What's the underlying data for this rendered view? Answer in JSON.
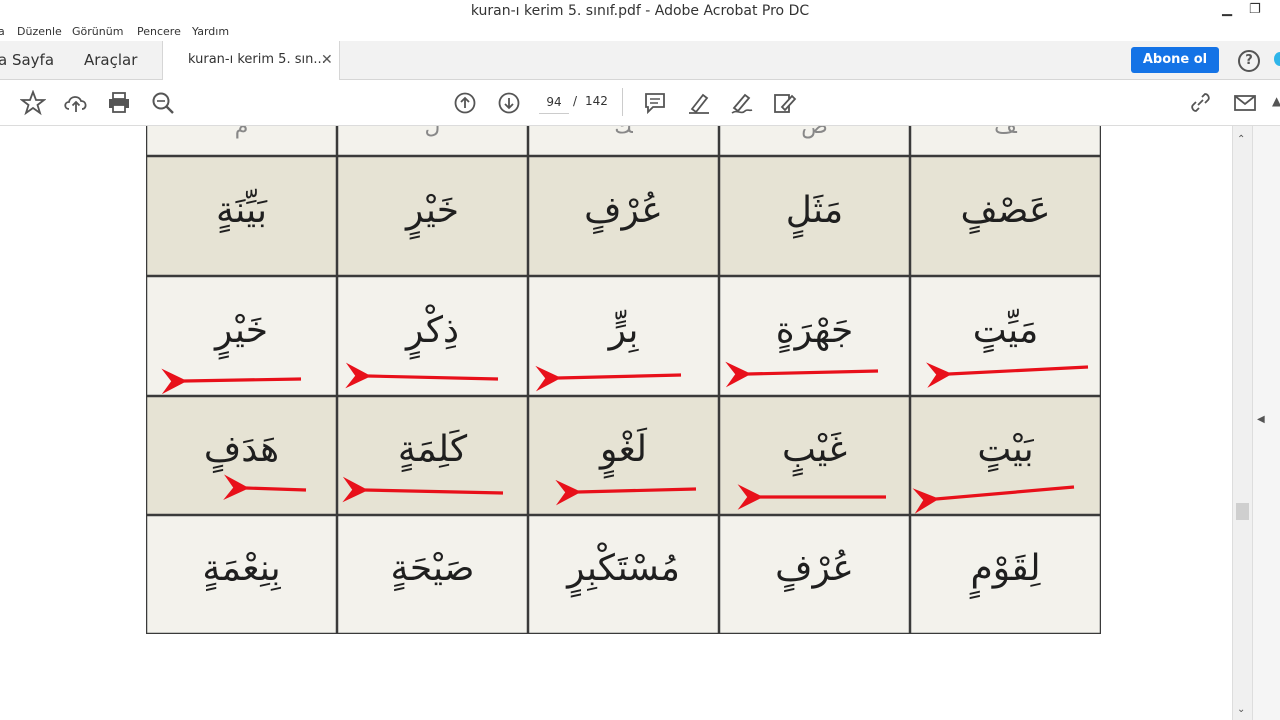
{
  "window": {
    "title": "kuran-ı kerim 5. sınıf.pdf - Adobe Acrobat Pro DC"
  },
  "menu": [
    "a",
    "Düzenle",
    "Görünüm",
    "Pencere",
    "Yardım"
  ],
  "tabs": {
    "home": "a Sayfa",
    "tools": "Araçlar",
    "doc": "kuran-ı kerim 5. sın..."
  },
  "header": {
    "subscribe_label": "Abone ol",
    "help_label": "?"
  },
  "toolbar": {
    "page_current": "94",
    "page_sep": "/",
    "page_total": "142",
    "icons": [
      "star-icon",
      "cloud-upload-icon",
      "print-icon",
      "zoom-icon",
      "page-up-icon",
      "page-down-icon",
      "comment-icon",
      "highlight-icon",
      "sign-icon",
      "fill-sign-icon",
      "share-link-icon",
      "email-icon"
    ]
  },
  "table": {
    "rows": [
      [
        "ﻒ",
        "ﺽ",
        "ﻚ",
        "ﻝ",
        "ﻡ"
      ],
      [
        "عَصْفٍ",
        "مَثَلٍ",
        "عُرْفٍ",
        "خَيْرٍ",
        "بَيِّنَةٍ"
      ],
      [
        "مَيِّتٍ",
        "جَهْرَةٍ",
        "بِرٍّ",
        "ذِكْرٍ",
        "خَيْرٍ"
      ],
      [
        "بَيْتٍ",
        "غَيْبٍ",
        "لَغْوٍ",
        "كَلِمَةٍ",
        "هَدَفٍ"
      ],
      [
        "لِقَوْمٍ",
        "عُرْفٍ",
        "مُسْتَكْبِرٍ",
        "صَيْحَةٍ",
        "بِنِعْمَةٍ"
      ]
    ],
    "arrow_color": "#e8101a"
  }
}
